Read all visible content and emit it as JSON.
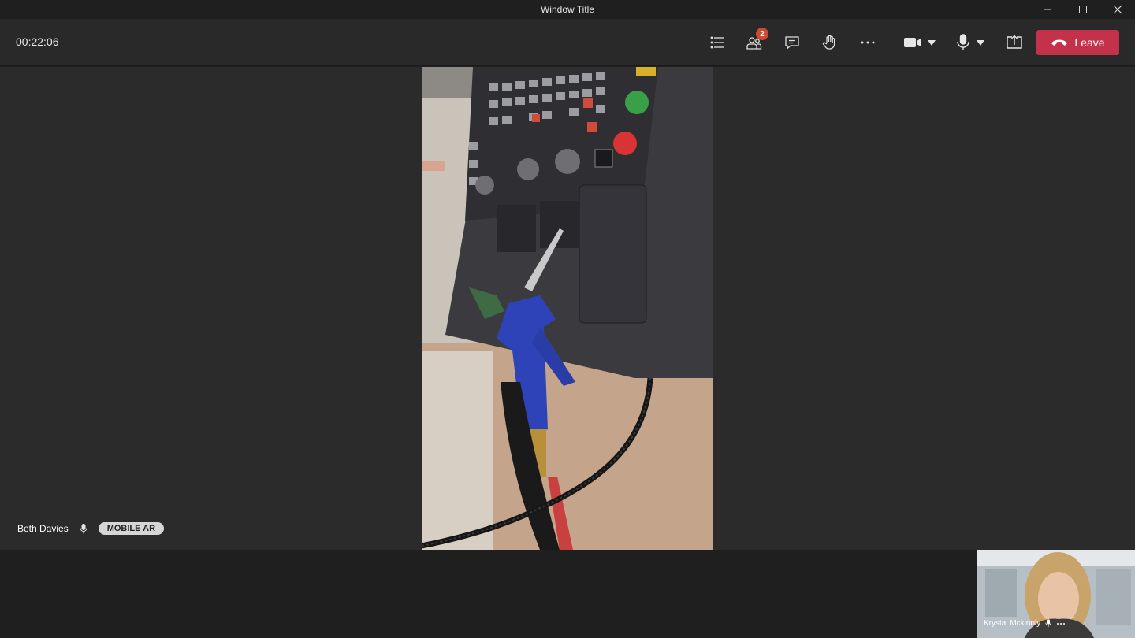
{
  "window": {
    "title": "Window Title"
  },
  "toolbar": {
    "timer": "00:22:06",
    "participants_badge": "2",
    "leave_label": "Leave"
  },
  "stage": {
    "presenter_name": "Beth Davies",
    "presenter_tag": "MOBILE AR"
  },
  "self_view": {
    "name": "Krystal Mckinnly"
  },
  "colors": {
    "leave_red": "#c4314b",
    "badge_red": "#cc4a31",
    "toolbar_bg": "#292929",
    "stage_bg": "#2b2b2b"
  },
  "icons": [
    "minimize-icon",
    "maximize-icon",
    "close-icon",
    "list-icon",
    "participants-icon",
    "chat-icon",
    "raise-hand-icon",
    "more-icon",
    "camera-icon",
    "chevron-down-icon",
    "microphone-icon",
    "share-screen-icon",
    "phone-hangup-icon"
  ]
}
